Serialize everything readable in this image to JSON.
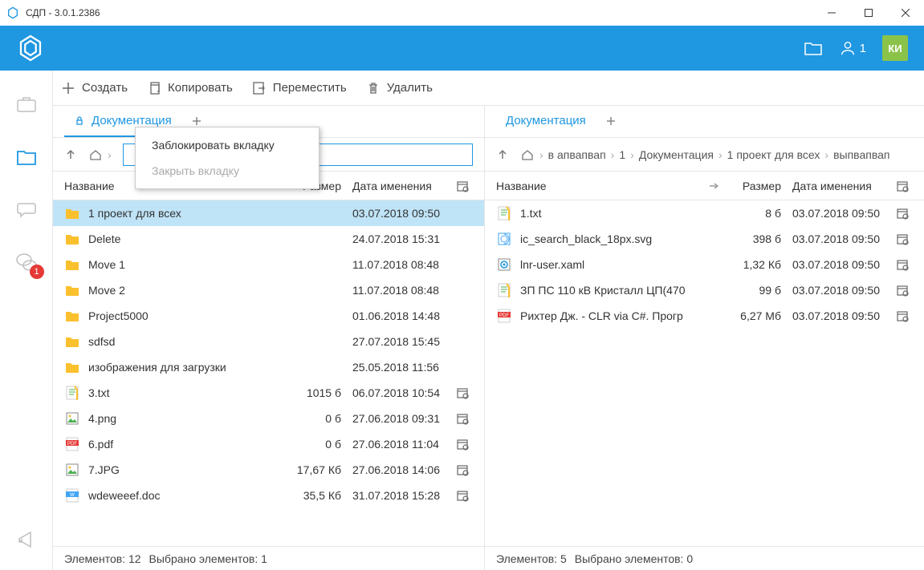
{
  "title": "СДП - 3.0.1.2386",
  "header": {
    "user_count": "1",
    "avatar": "КИ"
  },
  "sidebar": {
    "chat_badge": "1"
  },
  "toolbar": {
    "create": "Создать",
    "copy": "Копировать",
    "move": "Переместить",
    "delete": "Удалить"
  },
  "context_menu": {
    "lock": "Заблокировать вкладку",
    "close": "Закрыть вкладку"
  },
  "left": {
    "tab": "Документация",
    "columns": {
      "name": "Название",
      "size": "Размер",
      "date": "Дата именения"
    },
    "rows": [
      {
        "icon": "folder",
        "name": "1 проект для всех",
        "size": "",
        "date": "03.07.2018 09:50",
        "cal": false,
        "selected": true
      },
      {
        "icon": "folder",
        "name": "Delete",
        "size": "",
        "date": "24.07.2018 15:31",
        "cal": false
      },
      {
        "icon": "folder",
        "name": "Move 1",
        "size": "",
        "date": "11.07.2018 08:48",
        "cal": false
      },
      {
        "icon": "folder",
        "name": "Move 2",
        "size": "",
        "date": "11.07.2018 08:48",
        "cal": false
      },
      {
        "icon": "folder",
        "name": "Project5000",
        "size": "",
        "date": "01.06.2018 14:48",
        "cal": false
      },
      {
        "icon": "folder",
        "name": "sdfsd",
        "size": "",
        "date": "27.07.2018 15:45",
        "cal": false
      },
      {
        "icon": "folder",
        "name": "изображения для загрузки",
        "size": "",
        "date": "25.05.2018 11:56",
        "cal": false
      },
      {
        "icon": "txt",
        "name": "3.txt",
        "size": "1015 б",
        "date": "06.07.2018 10:54",
        "cal": true
      },
      {
        "icon": "img",
        "name": "4.png",
        "size": "0 б",
        "date": "27.06.2018 09:31",
        "cal": true
      },
      {
        "icon": "pdf",
        "name": "6.pdf",
        "size": "0 б",
        "date": "27.06.2018 11:04",
        "cal": true
      },
      {
        "icon": "img",
        "name": "7.JPG",
        "size": "17,67 Кб",
        "date": "27.06.2018 14:06",
        "cal": true
      },
      {
        "icon": "doc",
        "name": "wdeweeef.doc",
        "size": "35,5 Кб",
        "date": "31.07.2018 15:28",
        "cal": true
      }
    ],
    "status": {
      "elements": "Элементов: 12",
      "selected": "Выбрано элементов: 1"
    }
  },
  "right": {
    "tab": "Документация",
    "breadcrumbs": [
      "в апвапвап",
      "1",
      "Документация",
      "1 проект для всех",
      "выпвапвап"
    ],
    "columns": {
      "name": "Название",
      "size": "Размер",
      "date": "Дата именения"
    },
    "rows": [
      {
        "icon": "txt",
        "name": "1.txt",
        "size": "8 б",
        "date": "03.07.2018 09:50",
        "cal": true
      },
      {
        "icon": "svg",
        "name": "ic_search_black_18px.svg",
        "size": "398 б",
        "date": "03.07.2018 09:50",
        "cal": true
      },
      {
        "icon": "xaml",
        "name": "lnr-user.xaml",
        "size": "1,32 Кб",
        "date": "03.07.2018 09:50",
        "cal": true
      },
      {
        "icon": "txt",
        "name": "ЗП ПС 110 кВ Кристалл ЦП(470",
        "size": "99 б",
        "date": "03.07.2018 09:50",
        "cal": true
      },
      {
        "icon": "pdf",
        "name": "Рихтер Дж. - CLR via C#. Прогр",
        "size": "6,27 Мб",
        "date": "03.07.2018 09:50",
        "cal": true
      }
    ],
    "status": {
      "elements": "Элементов: 5",
      "selected": "Выбрано элементов: 0"
    }
  }
}
